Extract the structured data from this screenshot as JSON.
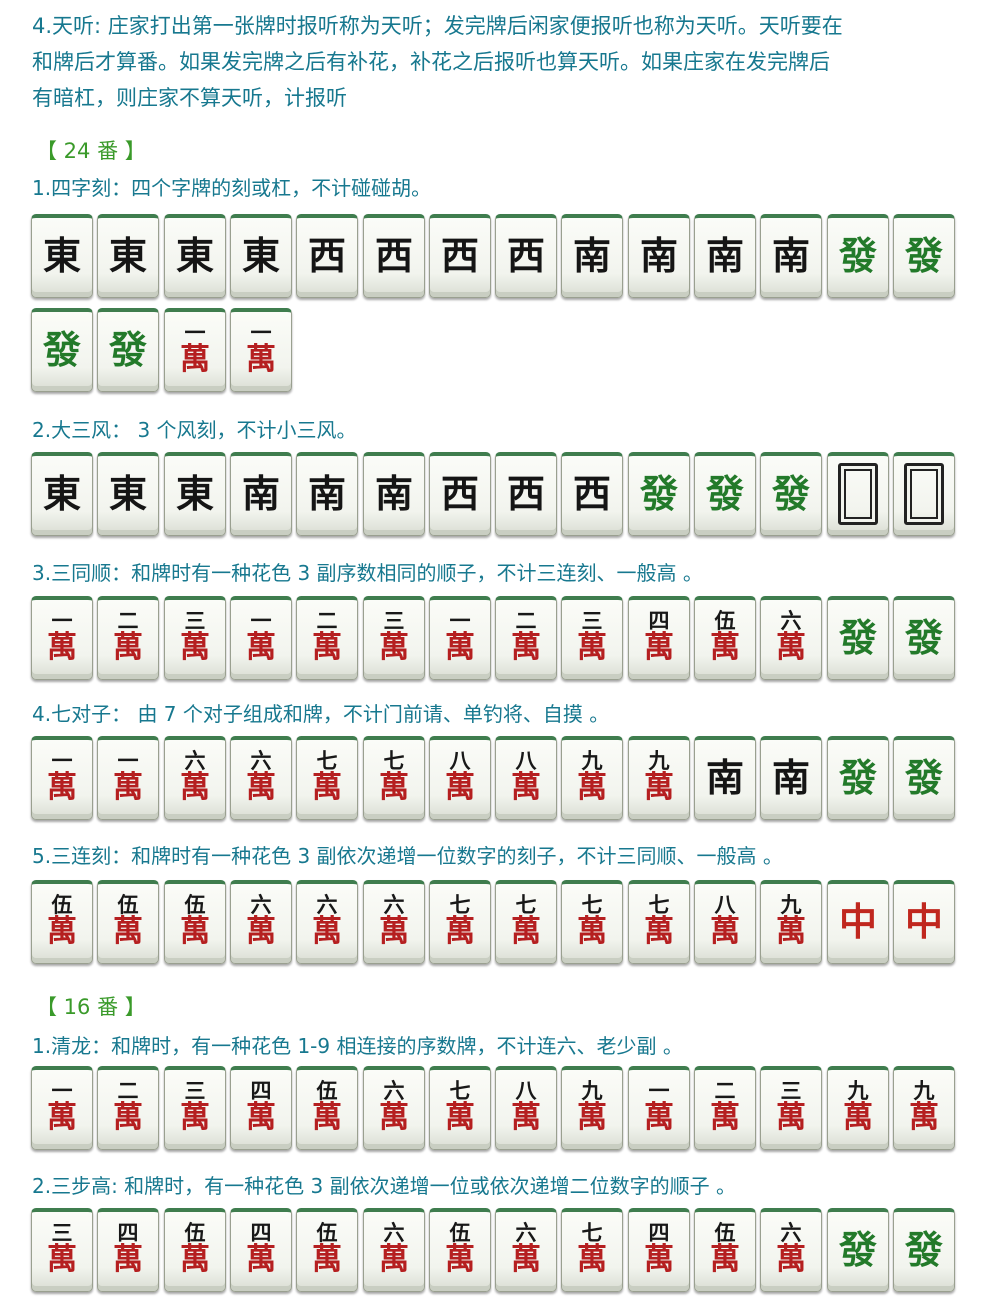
{
  "intro": {
    "line1": "4.天听: 庄家打出第一张牌时报听称为天听；发完牌后闲家便报听也称为天听。天听要在",
    "line2": "和牌后才算番。如果发完牌之后有补花，补花之后报听也算天听。如果庄家在发完牌后",
    "line3": "有暗杠，则庄家不算天听，计报听"
  },
  "sections": [
    {
      "heading": "【 24 番 】",
      "items": [
        {
          "caption": "1.四字刻：四个字牌的刻或杠，不计碰碰胡。",
          "rows": [
            [
              [
                "東",
                "black"
              ],
              [
                "東",
                "black"
              ],
              [
                "東",
                "black"
              ],
              [
                "東",
                "black"
              ],
              [
                "西",
                "black"
              ],
              [
                "西",
                "black"
              ],
              [
                "西",
                "black"
              ],
              [
                "西",
                "black"
              ],
              [
                "南",
                "black"
              ],
              [
                "南",
                "black"
              ],
              [
                "南",
                "black"
              ],
              [
                "南",
                "black"
              ],
              [
                "發",
                "green"
              ],
              [
                "發",
                "green"
              ]
            ],
            [
              [
                "發",
                "green"
              ],
              [
                "發",
                "green"
              ],
              [
                "一",
                "wan"
              ],
              [
                "一",
                "wan"
              ]
            ]
          ]
        },
        {
          "caption": "2.大三风： 3 个风刻，不计小三风。",
          "rows": [
            [
              [
                "東",
                "black"
              ],
              [
                "東",
                "black"
              ],
              [
                "東",
                "black"
              ],
              [
                "南",
                "black"
              ],
              [
                "南",
                "black"
              ],
              [
                "南",
                "black"
              ],
              [
                "西",
                "black"
              ],
              [
                "西",
                "black"
              ],
              [
                "西",
                "black"
              ],
              [
                "發",
                "green"
              ],
              [
                "發",
                "green"
              ],
              [
                "發",
                "green"
              ],
              [
                "",
                "blank"
              ],
              [
                "",
                "blank"
              ]
            ]
          ]
        },
        {
          "caption": "3.三同顺：和牌时有一种花色 3 副序数相同的顺子，不计三连刻、一般高 。",
          "rows": [
            [
              [
                "一",
                "wan"
              ],
              [
                "二",
                "wan"
              ],
              [
                "三",
                "wan"
              ],
              [
                "一",
                "wan"
              ],
              [
                "二",
                "wan"
              ],
              [
                "三",
                "wan"
              ],
              [
                "一",
                "wan"
              ],
              [
                "二",
                "wan"
              ],
              [
                "三",
                "wan"
              ],
              [
                "四",
                "wan"
              ],
              [
                "伍",
                "wan"
              ],
              [
                "六",
                "wan"
              ],
              [
                "發",
                "green"
              ],
              [
                "發",
                "green"
              ]
            ]
          ]
        },
        {
          "caption": "4.七对子： 由 7 个对子组成和牌，不计门前请、单钓将、自摸 。",
          "rows": [
            [
              [
                "一",
                "wan"
              ],
              [
                "一",
                "wan"
              ],
              [
                "六",
                "wan"
              ],
              [
                "六",
                "wan"
              ],
              [
                "七",
                "wan"
              ],
              [
                "七",
                "wan"
              ],
              [
                "八",
                "wan"
              ],
              [
                "八",
                "wan"
              ],
              [
                "九",
                "wan"
              ],
              [
                "九",
                "wan"
              ],
              [
                "南",
                "black"
              ],
              [
                "南",
                "black"
              ],
              [
                "發",
                "green"
              ],
              [
                "發",
                "green"
              ]
            ]
          ]
        },
        {
          "caption": "5.三连刻：和牌时有一种花色 3 副依次递增一位数字的刻子，不计三同顺、一般高 。",
          "rows": [
            [
              [
                "伍",
                "wan"
              ],
              [
                "伍",
                "wan"
              ],
              [
                "伍",
                "wan"
              ],
              [
                "六",
                "wan"
              ],
              [
                "六",
                "wan"
              ],
              [
                "六",
                "wan"
              ],
              [
                "七",
                "wan"
              ],
              [
                "七",
                "wan"
              ],
              [
                "七",
                "wan"
              ],
              [
                "七",
                "wan"
              ],
              [
                "八",
                "wan"
              ],
              [
                "九",
                "wan"
              ],
              [
                "中",
                "red"
              ],
              [
                "中",
                "red"
              ]
            ]
          ]
        }
      ]
    },
    {
      "heading": "【 16 番 】",
      "items": [
        {
          "caption": "1.清龙：和牌时，有一种花色 1-9 相连接的序数牌，不计连六、老少副 。",
          "rows": [
            [
              [
                "一",
                "wan"
              ],
              [
                "二",
                "wan"
              ],
              [
                "三",
                "wan"
              ],
              [
                "四",
                "wan"
              ],
              [
                "伍",
                "wan"
              ],
              [
                "六",
                "wan"
              ],
              [
                "七",
                "wan"
              ],
              [
                "八",
                "wan"
              ],
              [
                "九",
                "wan"
              ],
              [
                "一",
                "wan"
              ],
              [
                "二",
                "wan"
              ],
              [
                "三",
                "wan"
              ],
              [
                "九",
                "wan"
              ],
              [
                "九",
                "wan"
              ]
            ]
          ]
        },
        {
          "caption": "2.三步高: 和牌时，有一种花色 3 副依次递增一位或依次递增二位数字的顺子 。",
          "rows": [
            [
              [
                "三",
                "wan"
              ],
              [
                "四",
                "wan"
              ],
              [
                "伍",
                "wan"
              ],
              [
                "四",
                "wan"
              ],
              [
                "伍",
                "wan"
              ],
              [
                "六",
                "wan"
              ],
              [
                "伍",
                "wan"
              ],
              [
                "六",
                "wan"
              ],
              [
                "七",
                "wan"
              ],
              [
                "四",
                "wan"
              ],
              [
                "伍",
                "wan"
              ],
              [
                "六",
                "wan"
              ],
              [
                "發",
                "green"
              ],
              [
                "發",
                "green"
              ]
            ]
          ]
        }
      ]
    }
  ],
  "wan_char": "萬"
}
